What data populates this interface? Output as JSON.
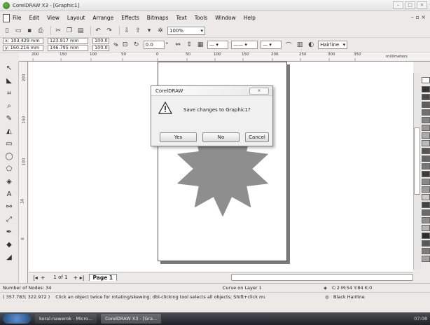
{
  "window": {
    "title": "CorelDRAW X3 - [Graphic1]",
    "controls": [
      "–",
      "□",
      "×"
    ]
  },
  "menu": [
    "File",
    "Edit",
    "View",
    "Layout",
    "Arrange",
    "Effects",
    "Bitmaps",
    "Text",
    "Tools",
    "Window",
    "Help"
  ],
  "toolbar1": {
    "zoom": "100%"
  },
  "property_bar": {
    "x": "x: 103.429 mm",
    "y": "y: 160.216 mm",
    "width": "123.917 mm",
    "height": "146.795 mm",
    "scale_w": "100.0",
    "scale_h": "100.0",
    "percent": "%",
    "angle": "0.0",
    "degree": "°",
    "outline": "Hairline"
  },
  "ruler": {
    "h_ticks": [
      "200",
      "150",
      "100",
      "50",
      "0",
      "50",
      "100",
      "150",
      "200",
      "250",
      "300",
      "350"
    ],
    "unit": "millimeters",
    "v_ticks": [
      "200",
      "150",
      "100",
      "50",
      "0"
    ]
  },
  "dialog": {
    "title": "CorelDRAW",
    "close": "⨯",
    "message": "Save changes to Graphic1?",
    "yes": "Yes",
    "no": "No",
    "cancel": "Cancel"
  },
  "nav": {
    "pages": "1 of 1",
    "page_tab": "Page 1"
  },
  "status": {
    "nodes": "Number of Nodes: 34",
    "layer": "Curve on Layer 1",
    "fill": "C:2 M:54 Y:84 K:0",
    "coords": "( 357.783; 322.972 )",
    "hint": "Click an object twice for rotating/skewing; dbl-clicking tool selects all objects; Shift+click multi-se...",
    "outline": "Black  Hairline"
  },
  "taskbar": {
    "task1": "koral-nawerok - Micro...",
    "task2": "CorelDRAW X3 - [Gra...",
    "clock": "07:08"
  },
  "colors": {
    "star": "#8e8e8e",
    "accent": "#2d7a1a"
  }
}
